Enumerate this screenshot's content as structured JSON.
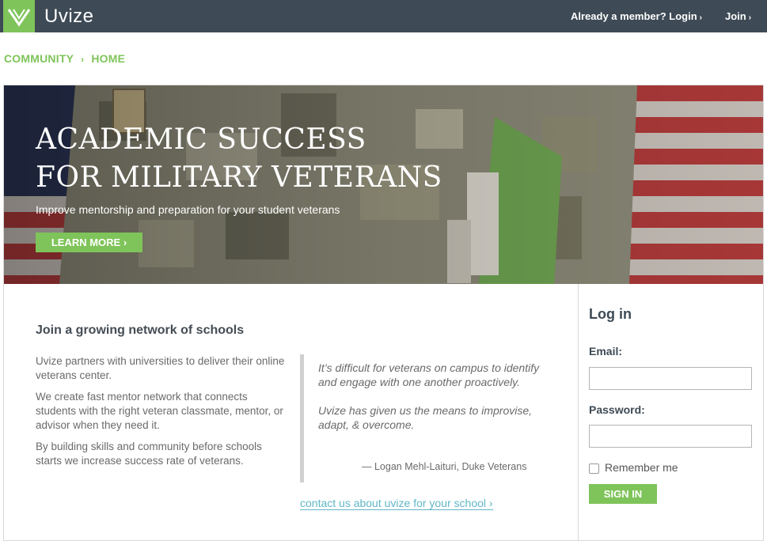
{
  "header": {
    "brand": "Uvize",
    "login_link": "Already a member? Login",
    "join_link": "Join",
    "chevron": "›"
  },
  "breadcrumb": {
    "items": [
      "COMMUNITY",
      "HOME"
    ],
    "separator": "›"
  },
  "hero": {
    "title_line1": "Academic Success",
    "title_line2": "for Military Veterans",
    "subtitle": "Improve mentorship and preparation for your student veterans",
    "button_label": "Learn more ›"
  },
  "main": {
    "heading": "Join a growing network of schools",
    "paragraphs": [
      "Uvize partners with universities to deliver their online veterans center.",
      "We create fast mentor network that connects students with the right veteran classmate, mentor, or advisor when they need it.",
      "By building skills and community before schools starts we increase success rate of veterans."
    ],
    "quote_line1": "It’s difficult for veterans on campus to identify and engage with one another proactively.",
    "quote_line2": "Uvize has given us the means to improvise, adapt, & overcome.",
    "quote_author": "— Logan Mehl-Laituri, Duke Veterans",
    "contact_link": "contact us about uvize for your school ›"
  },
  "login": {
    "title": "Log in",
    "email_label": "Email:",
    "email_value": "",
    "password_label": "Password:",
    "password_value": "",
    "remember_label": "Remember me",
    "remember_checked": false,
    "signin_label": "Sign in"
  },
  "colors": {
    "brand_green": "#7fc45a",
    "header_dark": "#3e4a55",
    "link_teal": "#5fb7c7"
  },
  "icons": {
    "logo": "chevron-v-logo-icon",
    "checkbox": "checkbox-icon"
  }
}
